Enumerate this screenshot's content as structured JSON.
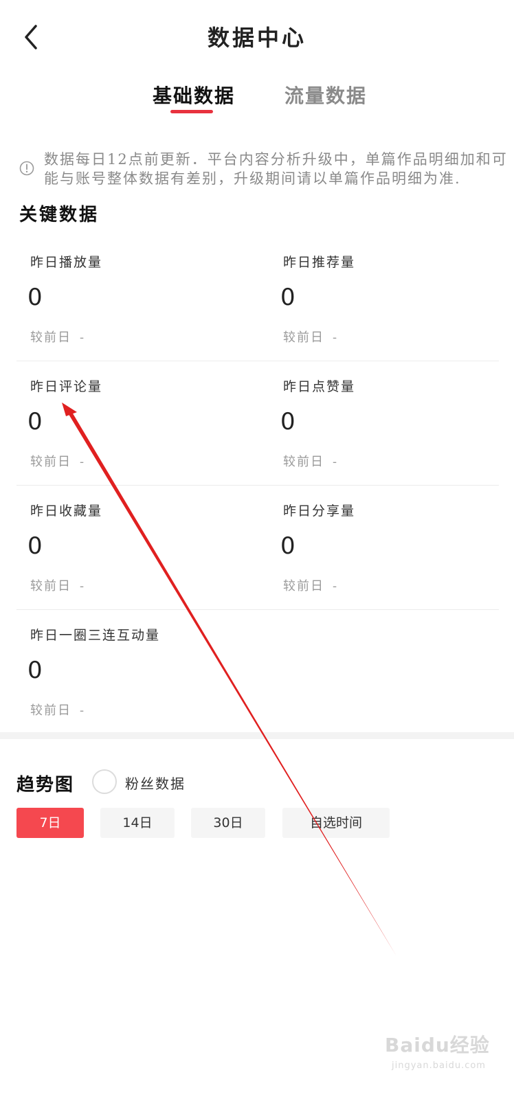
{
  "header": {
    "title": "数据中心"
  },
  "tabs": [
    {
      "label": "基础数据",
      "active": true
    },
    {
      "label": "流量数据",
      "active": false
    }
  ],
  "notice": {
    "text": "数据每日12点前更新．平台内容分析升级中，单篇作品明细加和可能与账号整体数据有差别，升级期间请以单篇作品明细为准."
  },
  "key_data": {
    "title": "关键数据",
    "compare_label": "较前日",
    "compare_value": "-",
    "metrics": [
      {
        "label": "昨日播放量",
        "value": "0"
      },
      {
        "label": "昨日推荐量",
        "value": "0"
      },
      {
        "label": "昨日评论量",
        "value": "0"
      },
      {
        "label": "昨日点赞量",
        "value": "0"
      },
      {
        "label": "昨日收藏量",
        "value": "0"
      },
      {
        "label": "昨日分享量",
        "value": "0"
      },
      {
        "label": "昨日一圈三连互动量",
        "value": "0"
      }
    ]
  },
  "trend": {
    "title": "趋势图",
    "fans_label": "粉丝数据",
    "periods": [
      {
        "label": "7日",
        "active": true
      },
      {
        "label": "14日",
        "active": false
      },
      {
        "label": "30日",
        "active": false
      },
      {
        "label": "自选时间",
        "active": false
      }
    ]
  },
  "watermark": {
    "main": "Baidu经验",
    "sub": "jingyan.baidu.com"
  },
  "colors": {
    "accent": "#e8323e",
    "active_button": "#f5484f",
    "annotation_arrow": "#e02020"
  }
}
